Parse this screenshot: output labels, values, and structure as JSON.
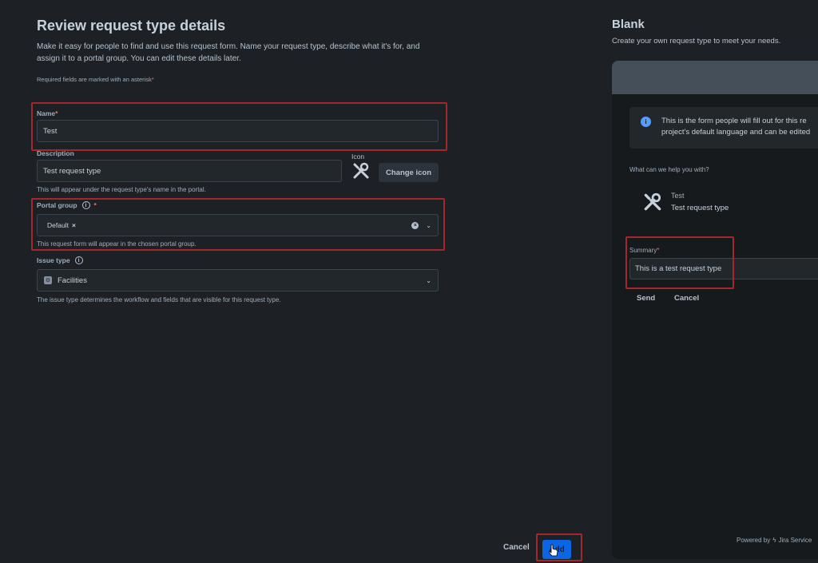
{
  "form": {
    "title": "Review request type details",
    "description": "Make it easy for people to find and use this request form. Name your request type, describe what it's for, and assign it to a portal group. You can edit these details later.",
    "required_note": "Required fields are marked with an asterisk",
    "asterisk": "*",
    "name": {
      "label": "Name",
      "value": "Test"
    },
    "description_field": {
      "label": "Description",
      "value": "Test request type",
      "helper": "This will appear under the request type's name in the portal."
    },
    "icon": {
      "label": "Icon",
      "change_label": "Change icon"
    },
    "portal_group": {
      "label": "Portal group",
      "tag": "Default",
      "tag_remove": "×",
      "helper": "This request form will appear in the chosen portal group."
    },
    "issue_type": {
      "label": "Issue type",
      "value": "Facilities",
      "helper": "The issue type determines the workflow and fields that are visible for this request type."
    },
    "cancel_label": "Cancel",
    "add_label": "Add"
  },
  "preview": {
    "title": "Blank",
    "subtitle": "Create your own request type to meet your needs.",
    "banner_line1": "This is the form people will fill out for this re",
    "banner_line2": "project's default language and can be edited",
    "help_label": "What can we help you with?",
    "request_name": "Test",
    "request_desc": "Test request type",
    "summary_label": "Summary",
    "summary_value": "This is a test request type",
    "send_label": "Send",
    "cancel_label": "Cancel",
    "powered_by": "Powered by",
    "powered_brand": "Jira Service"
  },
  "colors": {
    "accent": "#0c66e4",
    "highlight": "#a2282c",
    "info": "#579dff"
  }
}
